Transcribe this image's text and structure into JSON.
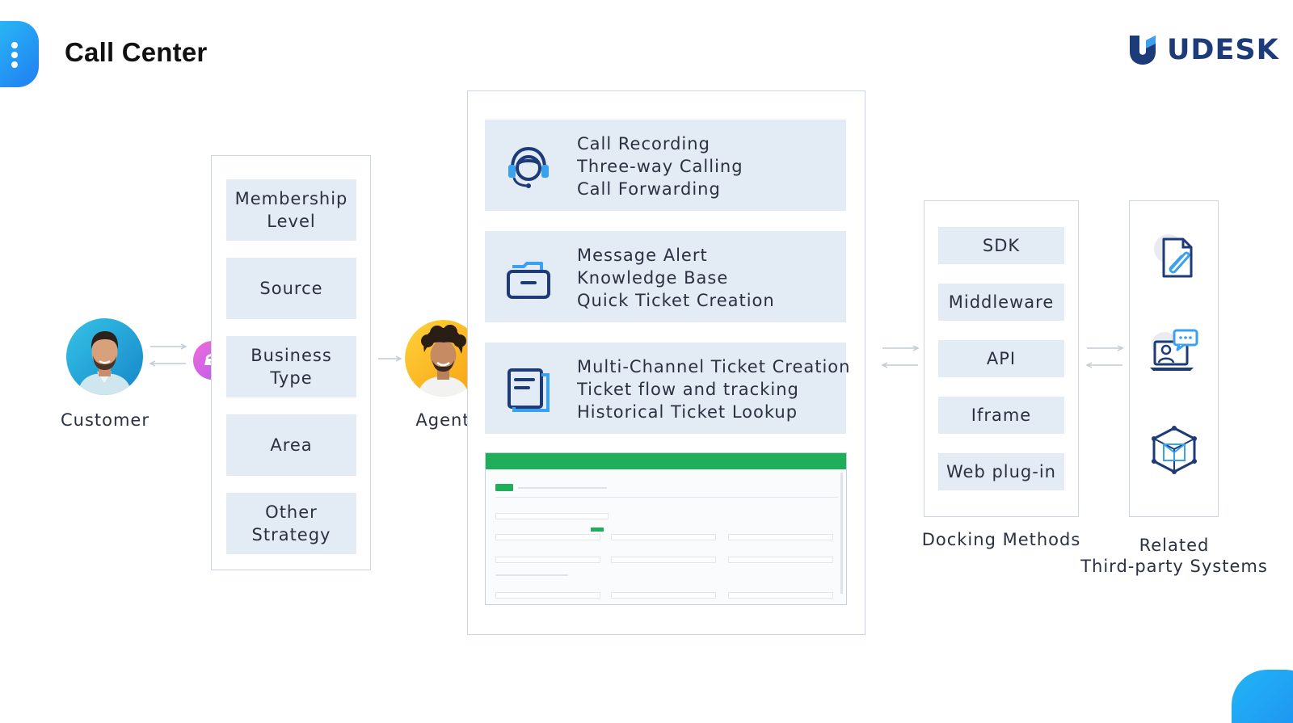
{
  "header": {
    "title": "Call Center",
    "logo_text": "UDESK"
  },
  "customer": {
    "label": "Customer"
  },
  "agent": {
    "label": "Agent"
  },
  "routing": {
    "items": [
      {
        "label_lines": [
          "Membership",
          "Level"
        ]
      },
      {
        "label_lines": [
          "Source"
        ]
      },
      {
        "label_lines": [
          "Business",
          "Type"
        ]
      },
      {
        "label_lines": [
          "Area"
        ]
      },
      {
        "label_lines": [
          "Other",
          "Strategy"
        ]
      }
    ]
  },
  "features": [
    {
      "icon": "headset-icon",
      "lines": [
        "Call Recording",
        "Three-way Calling",
        "Call Forwarding"
      ]
    },
    {
      "icon": "folder-icon",
      "lines": [
        "Message Alert",
        "Knowledge Base",
        "Quick Ticket Creation"
      ]
    },
    {
      "icon": "document-icon",
      "lines": [
        "Multi-Channel Ticket Creation",
        "Ticket flow and tracking",
        "Historical Ticket Lookup"
      ]
    }
  ],
  "docking": {
    "caption": "Docking Methods",
    "items": [
      "SDK",
      "Middleware",
      "API",
      "Iframe",
      "Web plug-in"
    ]
  },
  "third_party": {
    "caption_lines": [
      "Related",
      "Third-party Systems"
    ],
    "icons": [
      "attachment-document-icon",
      "laptop-chat-icon",
      "cube-network-icon"
    ]
  },
  "colors": {
    "accent_blue": "#1f7ef2",
    "tile_bg": "#e3ebf4",
    "brand_navy": "#1d3b78",
    "screen_green": "#1fae5a"
  }
}
